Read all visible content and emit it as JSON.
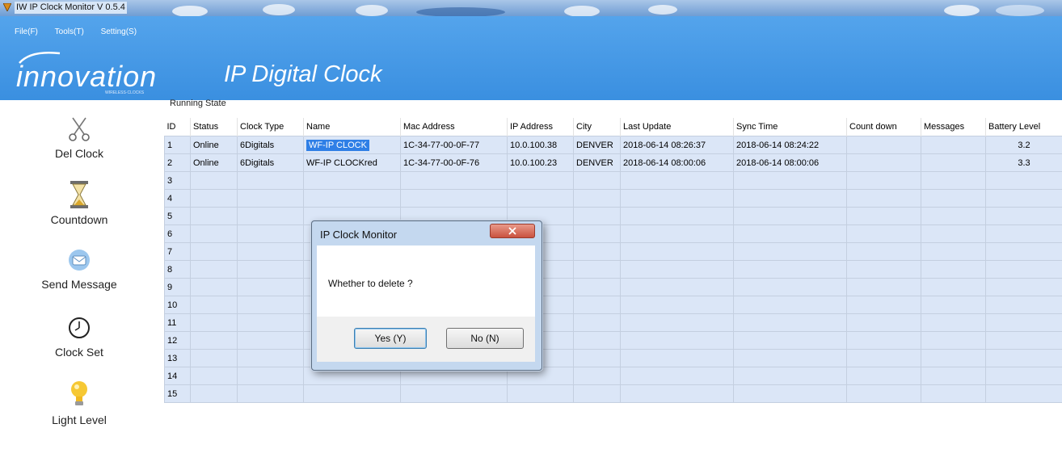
{
  "window": {
    "title": "IW IP Clock Monitor V 0.5.4"
  },
  "menu": [
    "File(F)",
    "Tools(T)",
    "Setting(S)"
  ],
  "brand": {
    "logo": "innovation",
    "tagline": "WIRELESS·CLOCKS",
    "app_heading": "IP Digital Clock"
  },
  "section_label": "Running State",
  "sidebar": [
    {
      "label": "Del Clock",
      "icon": "scissors-icon"
    },
    {
      "label": "Countdown",
      "icon": "hourglass-icon"
    },
    {
      "label": "Send Message",
      "icon": "message-icon"
    },
    {
      "label": "Clock Set",
      "icon": "clock-icon"
    },
    {
      "label": "Light Level",
      "icon": "lightbulb-icon"
    }
  ],
  "table": {
    "columns": [
      "ID",
      "Status",
      "Clock Type",
      "Name",
      "Mac Address",
      "IP Address",
      "City",
      "Last Update",
      "Sync Time",
      "Count down",
      "Messages",
      "Battery Level"
    ],
    "rows": [
      {
        "id": "1",
        "status": "Online",
        "clock_type": "6Digitals",
        "name": "WF-IP CLOCK",
        "mac": "1C-34-77-00-0F-77",
        "ip": "10.0.100.38",
        "city": "DENVER",
        "last_update": "2018-06-14 08:26:37",
        "sync_time": "2018-06-14 08:24:22",
        "countdown": "",
        "messages": "",
        "battery": "3.2",
        "selected": true
      },
      {
        "id": "2",
        "status": "Online",
        "clock_type": "6Digitals",
        "name": "WF-IP CLOCKred",
        "mac": "1C-34-77-00-0F-76",
        "ip": "10.0.100.23",
        "city": "DENVER",
        "last_update": "2018-06-14 08:00:06",
        "sync_time": "2018-06-14 08:00:06",
        "countdown": "",
        "messages": "",
        "battery": "3.3",
        "selected": false
      },
      {
        "id": "3"
      },
      {
        "id": "4"
      },
      {
        "id": "5"
      },
      {
        "id": "6"
      },
      {
        "id": "7"
      },
      {
        "id": "8"
      },
      {
        "id": "9"
      },
      {
        "id": "10"
      },
      {
        "id": "11"
      },
      {
        "id": "12"
      },
      {
        "id": "13"
      },
      {
        "id": "14"
      },
      {
        "id": "15"
      }
    ]
  },
  "dialog": {
    "title": "IP Clock Monitor",
    "message": "Whether to delete ?",
    "yes_label": "Yes (Y)",
    "no_label": "No (N)"
  },
  "colors": {
    "header_blue": "#4a9ae8",
    "cell_blue": "#dbe6f7",
    "selection_blue": "#2f7fe6",
    "close_red": "#c9523f"
  }
}
